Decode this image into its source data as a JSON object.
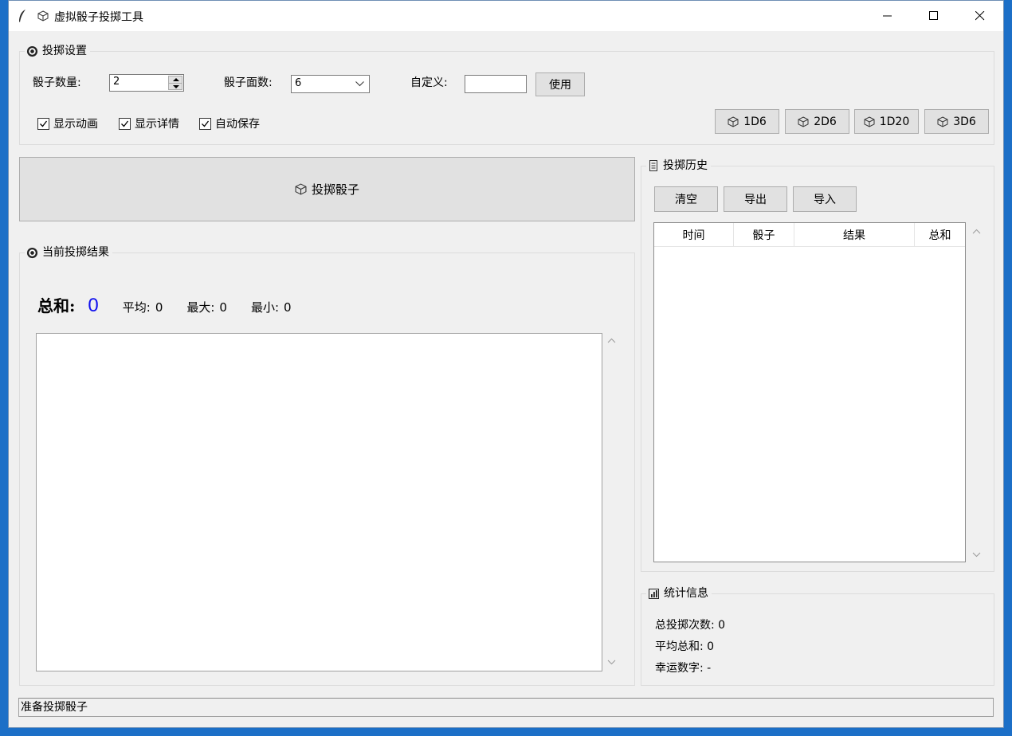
{
  "window": {
    "title": "虚拟骰子投掷工具"
  },
  "settings": {
    "title": "投掷设置",
    "dice_count_label": "骰子数量:",
    "dice_count_value": "2",
    "dice_faces_label": "骰子面数:",
    "dice_faces_value": "6",
    "custom_label": "自定义:",
    "custom_value": "",
    "use_button": "使用",
    "checkboxes": [
      {
        "label": "显示动画",
        "checked": true
      },
      {
        "label": "显示详情",
        "checked": true
      },
      {
        "label": "自动保存",
        "checked": true
      }
    ],
    "presets": [
      "1D6",
      "2D6",
      "1D20",
      "3D6"
    ]
  },
  "roll_button": "投掷骰子",
  "results": {
    "title": "当前投掷结果",
    "sum_label": "总和:",
    "sum_value": "0",
    "avg_label": "平均:",
    "avg_value": "0",
    "max_label": "最大:",
    "max_value": "0",
    "min_label": "最小:",
    "min_value": "0"
  },
  "history": {
    "title": "投掷历史",
    "buttons": [
      "清空",
      "导出",
      "导入"
    ],
    "columns": [
      "时间",
      "骰子",
      "结果",
      "总和"
    ]
  },
  "stats": {
    "title": "统计信息",
    "total_rolls": "总投掷次数: 0",
    "avg_sum": "平均总和: 0",
    "lucky_number": "幸运数字: -"
  },
  "status": "准备投掷骰子",
  "colors": {
    "sum_value": "#1010ee",
    "desktop": "#1c6fc7"
  }
}
